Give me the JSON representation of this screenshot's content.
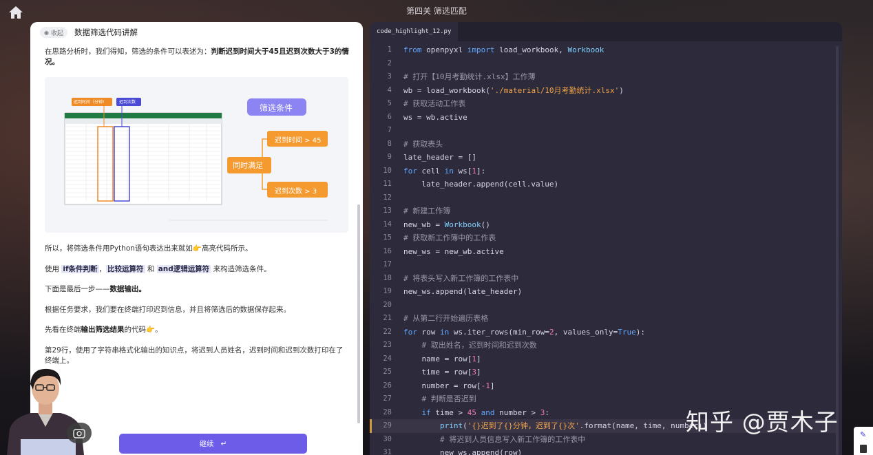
{
  "header": {
    "title": "第四关 筛选匹配"
  },
  "left_panel": {
    "collapse_label": "收起",
    "title": "数据筛选代码讲解",
    "intro": "在思路分析时，我们得知，筛选的条件可以表述为：",
    "intro_bold": "判断迟到时间大于45且迟到次数大于3的情况。",
    "figure": {
      "tag_time": "迟到时间（分钟）",
      "tag_count": "迟到次数",
      "filter_title": "筛选条件",
      "both": "同时满足",
      "cond1": "迟到时间 > 45",
      "cond2": "迟到次数 > 3"
    },
    "p1": "所以，将筛选条件用Python语句表达出来就如",
    "p1_end": "高亮代码所示。",
    "p2_pre": "使用 ",
    "p2_hl1": "if条件判断",
    "p2_mid1": "，",
    "p2_hl2": "比较运算符",
    "p2_mid2": " 和 ",
    "p2_hl3": "and逻辑运算符",
    "p2_post": " 来构造筛选条件。",
    "p3_pre": "下面是最后一步——",
    "p3_bold": "数据输出。",
    "p4": "根据任务要求，我们要在终端打印迟到信息，并且将筛选后的数据保存起来。",
    "p5_pre": "先看在终端",
    "p5_bold": "输出筛选结果",
    "p5_post": "的代码",
    "p5_end": "。",
    "p6": "第29行，使用了字符串格式化输出的知识点，将迟到人员姓名，迟到时间和迟到次数打印在了终端上。",
    "continue_label": "继续"
  },
  "code_panel": {
    "tab": "code_highlight_12.py",
    "active_line": 29,
    "lines": [
      {
        "n": "1",
        "html": "<span class='k'>from</span> openpyxl <span class='k'>import</span> load_workbook, <span class='f'>Workbook</span>"
      },
      {
        "n": "2",
        "html": ""
      },
      {
        "n": "3",
        "html": "<span class='c'># 打开【10月考勤统计.xlsx】工作薄</span>"
      },
      {
        "n": "4",
        "html": "wb = load_workbook(<span class='s'>'./material/10月考勤统计.xlsx'</span>)"
      },
      {
        "n": "5",
        "html": "<span class='c'># 获取活动工作表</span>"
      },
      {
        "n": "6",
        "html": "ws = wb.active"
      },
      {
        "n": "7",
        "html": ""
      },
      {
        "n": "8",
        "html": "<span class='c'># 获取表头</span>"
      },
      {
        "n": "9",
        "html": "late_header = []"
      },
      {
        "n": "10",
        "html": "<span class='k'>for</span> cell <span class='k'>in</span> ws[<span class='n'>1</span>]:"
      },
      {
        "n": "11",
        "html": "    late_header.append(cell.value)"
      },
      {
        "n": "12",
        "html": ""
      },
      {
        "n": "13",
        "html": "<span class='c'># 新建工作簿</span>"
      },
      {
        "n": "14",
        "html": "new_wb = <span class='f'>Workbook</span>()"
      },
      {
        "n": "15",
        "html": "<span class='c'># 获取新工作簿中的工作表</span>"
      },
      {
        "n": "16",
        "html": "new_ws = new_wb.active"
      },
      {
        "n": "17",
        "html": ""
      },
      {
        "n": "18",
        "html": "<span class='c'># 将表头写入新工作簿的工作表中</span>"
      },
      {
        "n": "19",
        "html": "new_ws.append(late_header)"
      },
      {
        "n": "20",
        "html": ""
      },
      {
        "n": "21",
        "html": "<span class='c'># 从第二行开始遍历表格</span>"
      },
      {
        "n": "22",
        "html": "<span class='k'>for</span> row <span class='k'>in</span> ws.iter_rows(min_row=<span class='n'>2</span>, values_only=<span class='k'>True</span>):"
      },
      {
        "n": "23",
        "html": "    <span class='c'># 取出姓名，迟到时间和迟到次数</span>"
      },
      {
        "n": "24",
        "html": "    name = row[<span class='n'>1</span>]"
      },
      {
        "n": "25",
        "html": "    time = row[<span class='n'>3</span>]"
      },
      {
        "n": "26",
        "html": "    number = row[<span class='n'>-1</span>]"
      },
      {
        "n": "27",
        "html": "    <span class='c'># 判断是否迟到</span>"
      },
      {
        "n": "28",
        "html": "    <span class='k'>if</span> time &gt; <span class='n'>45</span> <span class='k'>and</span> number &gt; <span class='n'>3</span>:"
      },
      {
        "n": "29",
        "html": "        <span class='f'>print</span>(<span class='s'>'{}迟到了{}分钟，迟到了{}次'</span>.format(name, time, number))"
      },
      {
        "n": "30",
        "html": "        <span class='c'># 将迟到人员信息写入新工作簿的工作表中</span>"
      },
      {
        "n": "31",
        "html": "        new_ws.append(row)"
      }
    ]
  },
  "watermark": "知乎 @贾木子"
}
